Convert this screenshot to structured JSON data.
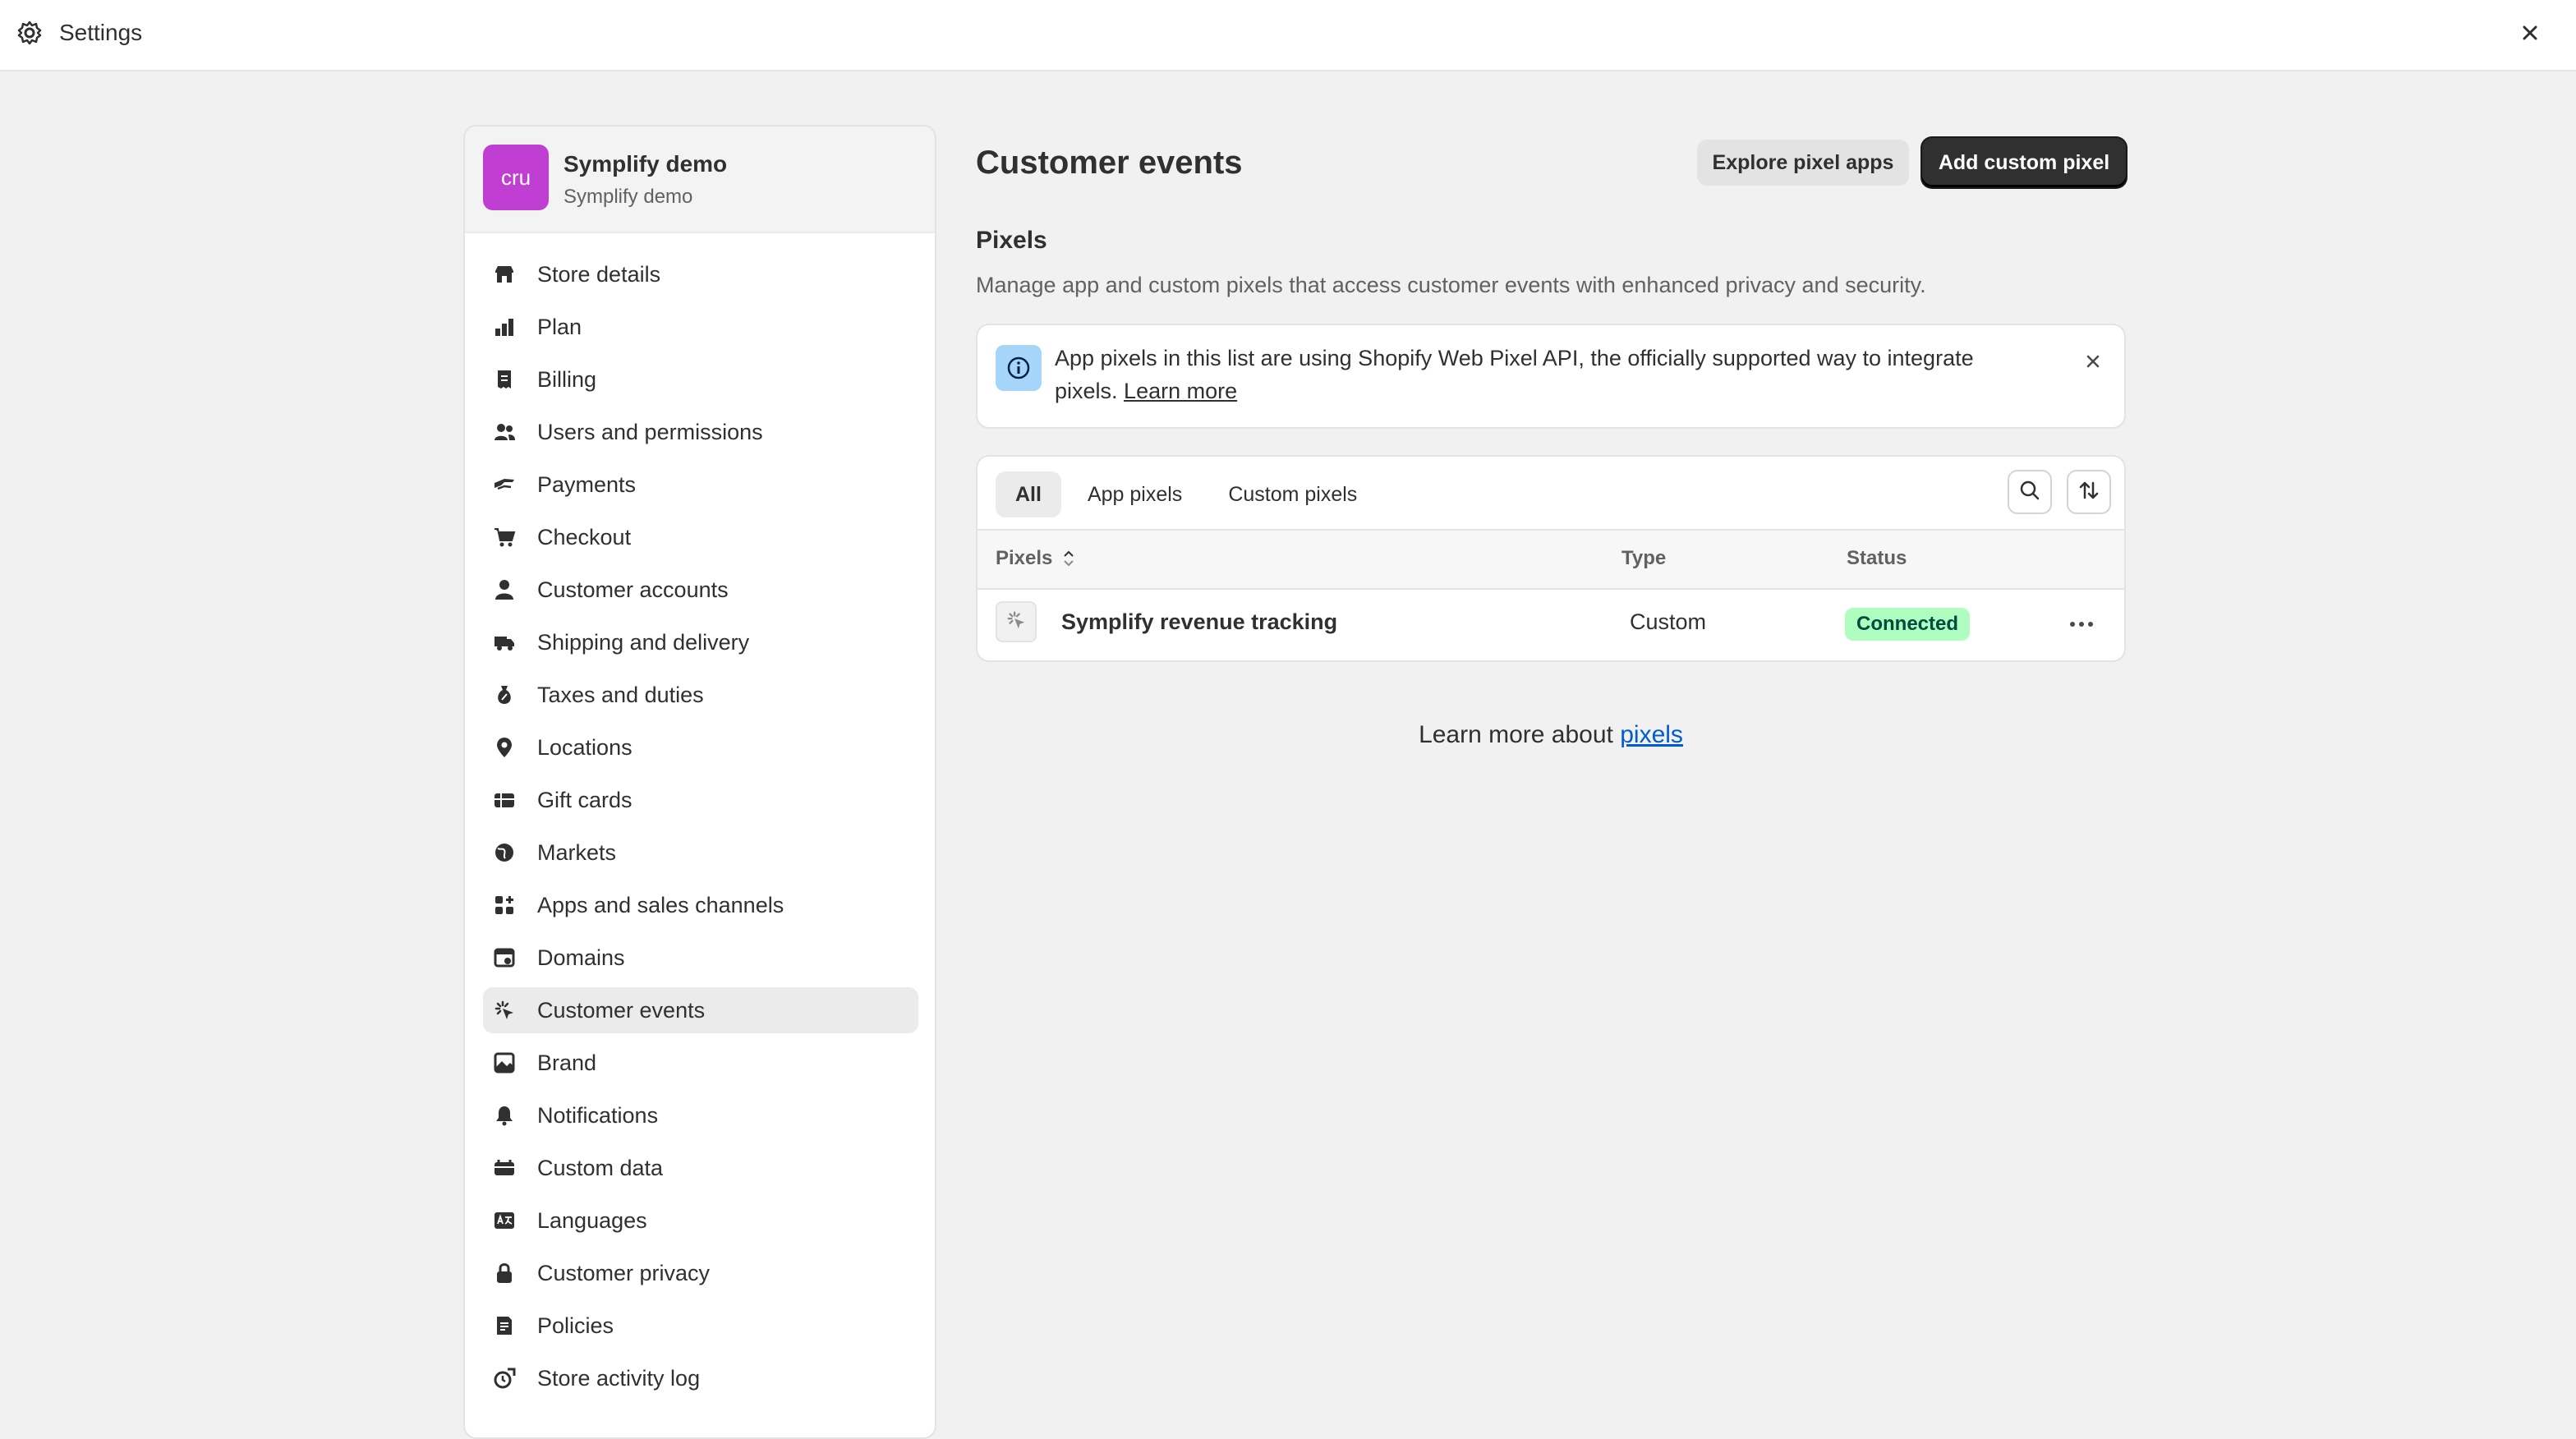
{
  "topbar": {
    "title": "Settings",
    "icons": {
      "settings": "gear-icon",
      "close": "close-icon"
    }
  },
  "store": {
    "avatar_text": "cru",
    "name": "Symplify demo",
    "subtitle": "Symplify demo",
    "avatar_color": "#c03ed1"
  },
  "sidebar": {
    "items": [
      {
        "label": "Store details",
        "icon": "store-icon"
      },
      {
        "label": "Plan",
        "icon": "plan-icon"
      },
      {
        "label": "Billing",
        "icon": "billing-icon"
      },
      {
        "label": "Users and permissions",
        "icon": "users-icon"
      },
      {
        "label": "Payments",
        "icon": "payments-icon"
      },
      {
        "label": "Checkout",
        "icon": "cart-icon"
      },
      {
        "label": "Customer accounts",
        "icon": "person-icon"
      },
      {
        "label": "Shipping and delivery",
        "icon": "truck-icon"
      },
      {
        "label": "Taxes and duties",
        "icon": "tax-icon"
      },
      {
        "label": "Locations",
        "icon": "location-icon"
      },
      {
        "label": "Gift cards",
        "icon": "gift-card-icon"
      },
      {
        "label": "Markets",
        "icon": "globe-icon"
      },
      {
        "label": "Apps and sales channels",
        "icon": "apps-icon"
      },
      {
        "label": "Domains",
        "icon": "domains-icon"
      },
      {
        "label": "Customer events",
        "icon": "cursor-click-icon",
        "active": true
      },
      {
        "label": "Brand",
        "icon": "brand-icon"
      },
      {
        "label": "Notifications",
        "icon": "bell-icon"
      },
      {
        "label": "Custom data",
        "icon": "custom-data-icon"
      },
      {
        "label": "Languages",
        "icon": "language-icon"
      },
      {
        "label": "Customer privacy",
        "icon": "lock-icon"
      },
      {
        "label": "Policies",
        "icon": "policies-icon"
      },
      {
        "label": "Store activity log",
        "icon": "activity-icon"
      }
    ]
  },
  "main": {
    "title": "Customer events",
    "explore_button": "Explore pixel apps",
    "add_button": "Add custom pixel",
    "section_title": "Pixels",
    "section_desc": "Manage app and custom pixels that access customer events with enhanced privacy and security.",
    "banner": {
      "text": "App pixels in this list are using Shopify Web Pixel API, the officially supported way to integrate pixels.",
      "link": "Learn more"
    },
    "tabs": [
      "All",
      "App pixels",
      "Custom pixels"
    ],
    "table": {
      "headers": {
        "pixels": "Pixels",
        "type": "Type",
        "status": "Status"
      },
      "rows": [
        {
          "name": "Symplify revenue tracking",
          "type": "Custom",
          "status": "Connected"
        }
      ]
    },
    "footer_prefix": "Learn more about",
    "footer_link": "pixels"
  },
  "colors": {
    "primary_button": "#303030",
    "status_badge_bg": "#affebf",
    "link": "#005bd3",
    "info_box": "#a6d5fa"
  }
}
